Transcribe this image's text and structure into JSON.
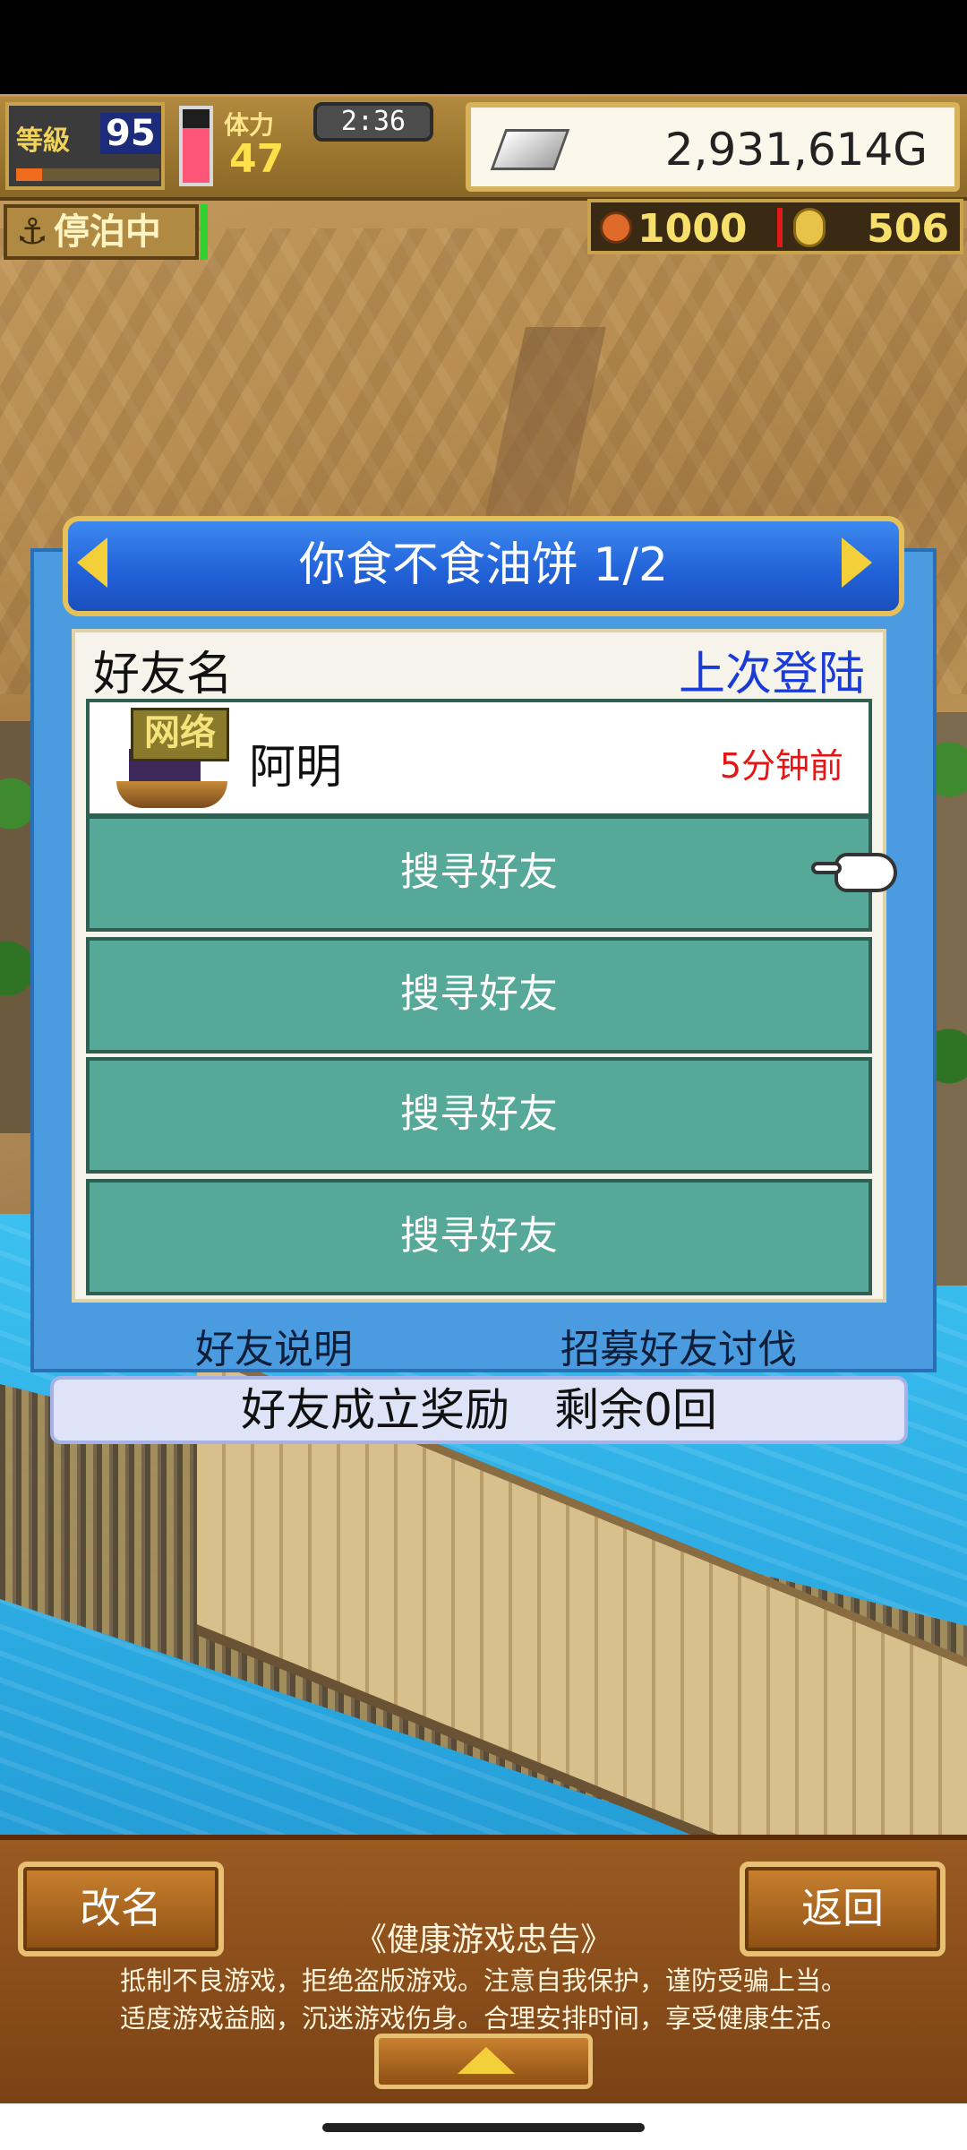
{
  "hud": {
    "level_label": "等級",
    "level_value": "95",
    "level_progress": 0.18,
    "stamina_label": "体力",
    "stamina_value": "47",
    "stamina_fill": 0.75,
    "timer": "2:36",
    "money": "2,931,614G",
    "dock_status": "停泊中",
    "resource_a": "1000",
    "resource_b": "506"
  },
  "panel": {
    "title": "你食不食油饼 1/2",
    "col_friend_name": "好友名",
    "col_last_login": "上次登陆",
    "friend": {
      "badge": "网络",
      "name": "阿明",
      "last_login": "5分钟前"
    },
    "slots": [
      "搜寻好友",
      "搜寻好友",
      "搜寻好友",
      "搜寻好友"
    ],
    "link_explain": "好友说明",
    "link_recruit": "招募好友讨伐",
    "bonus": "好友成立奖励　剩余0回"
  },
  "bottom": {
    "rename_label": "改名",
    "back_label": "返回",
    "notice_title": "《健康游戏忠告》",
    "notice_line1": "抵制不良游戏，拒绝盗版游戏。注意自我保护，谨防受骗上当。",
    "notice_line2": "适度游戏益脑，沉迷游戏伤身。合理安排时间，享受健康生活。"
  },
  "colors": {
    "panel_blue": "#4a9be0",
    "slot_teal": "#56a898",
    "login_blue": "#1a3bd8",
    "time_red": "#e41515"
  }
}
